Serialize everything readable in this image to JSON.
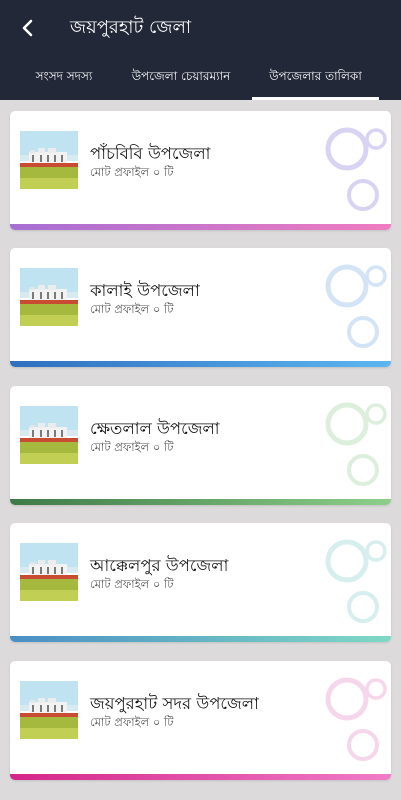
{
  "header": {
    "title": "জয়পুরহাট জেলা",
    "back_icon": "arrow-left-icon"
  },
  "tabs": [
    {
      "label": "সংসদ সদস্য",
      "active": false
    },
    {
      "label": "উপজেলা চেয়ারম্যান",
      "active": false
    },
    {
      "label": "উপজেলার তালিকা",
      "active": true
    }
  ],
  "colors": {
    "header_bg": "#222838",
    "page_bg": "#dcdadb"
  },
  "cards": [
    {
      "name": "পাঁচবিবি উপজেলা",
      "count": "মোট প্রফাইল ০ টি",
      "bar_from": "#a66ed3",
      "bar_to": "#f07cc0",
      "deco": "#d9d3f3"
    },
    {
      "name": "কালাই উপজেলা",
      "count": "মোট প্রফাইল ০ টি",
      "bar_from": "#2f6fbe",
      "bar_to": "#5cb6f1",
      "deco": "#d3e4f6"
    },
    {
      "name": "ক্ষেতলাল উপজেলা",
      "count": "মোট প্রফাইল ০ টি",
      "bar_from": "#3e7a47",
      "bar_to": "#8dcf8a",
      "deco": "#dcefdc"
    },
    {
      "name": "আক্কেলপুর উপজেলা",
      "count": "মোট প্রফাইল ০ টি",
      "bar_from": "#4a8fc4",
      "bar_to": "#7fd9c5",
      "deco": "#d6eeee"
    },
    {
      "name": "জয়পুরহাট সদর উপজেলা",
      "count": "মোট প্রফাইল ০ টি",
      "bar_from": "#d4268a",
      "bar_to": "#f07cc8",
      "deco": "#f6d6ea"
    }
  ]
}
